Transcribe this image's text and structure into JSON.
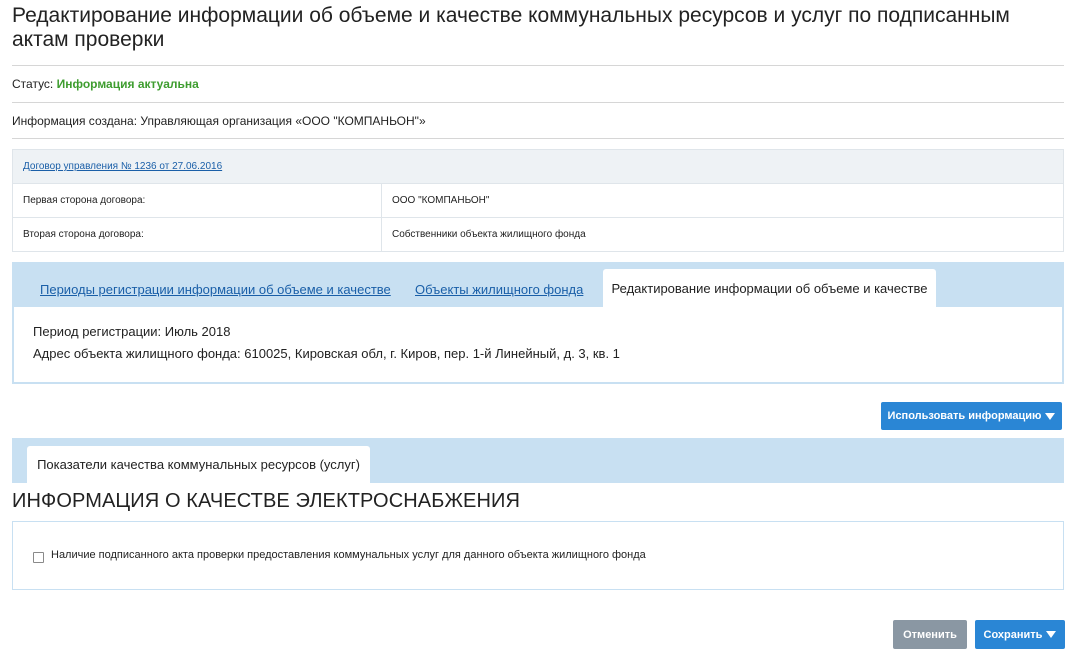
{
  "page": {
    "title": "Редактирование информации об объеме и качестве коммунальных ресурсов и услуг по подписанным актам проверки"
  },
  "status": {
    "label": "Статус:",
    "value": "Информация актуальна"
  },
  "created": {
    "text": "Информация создана: Управляющая организация «ООО \"КОМПАНЬОН\"»"
  },
  "contract": {
    "link": "Договор управления № 1236 от 27.06.2016",
    "rows": [
      {
        "label": "Первая сторона договора:",
        "value": "ООО \"КОМПАНЬОН\""
      },
      {
        "label": "Вторая сторона договора:",
        "value": "Собственники объекта жилищного фонда"
      }
    ]
  },
  "tabs": [
    {
      "label": "Периоды регистрации информации об объеме и качестве"
    },
    {
      "label": "Объекты жилищного фонда"
    },
    {
      "label": "Редактирование информации об объеме и качестве"
    }
  ],
  "tab_body": {
    "period": "Период регистрации: Июль 2018",
    "address": "Адрес объекта жилищного фонда: 610025, Кировская обл, г. Киров, пер. 1-й Линейный, д. 3, кв. 1"
  },
  "use_info_button": "Использовать информацию",
  "quality_tab": "Показатели качества коммунальных ресурсов (услуг)",
  "section_heading": "ИНФОРМАЦИЯ О КАЧЕСТВЕ ЭЛЕКТРОСНАБЖЕНИЯ",
  "checkbox": {
    "label": "Наличие подписанного акта проверки предоставления коммунальных услуг для данного объекта жилищного фонда",
    "checked": false
  },
  "footer": {
    "cancel": "Отменить",
    "save": "Сохранить"
  },
  "colors": {
    "accent": "#2a86d5",
    "status_ok": "#3e9d2f",
    "tab_strip": "#c8e0f2",
    "link": "#1a5fa8"
  }
}
